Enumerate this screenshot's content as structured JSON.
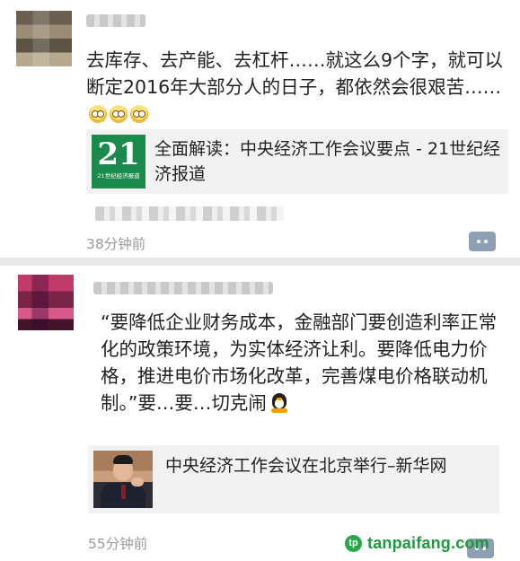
{
  "post1": {
    "text": "去库存、去产能、去杠杆……就这么9个字，就可以断定2016年大部分人的日子，都依然会很艰苦……",
    "emoji_count": 3,
    "card": {
      "thumb_number": "21",
      "thumb_caption": "21世纪经济报道",
      "title": "全面解读：中央经济工作会议要点 - 21世纪经济报道"
    },
    "timestamp": "38分钟前"
  },
  "post2": {
    "text": "“要降低企业财务成本，金融部门要创造利率正常化的政策环境，为实体经济让利。要降低电力价格，推进电价市场化改革，完善煤电价格联动机制。”要…要…切克闹",
    "card": {
      "title": "中央经济工作会议在北京举行–新华网"
    },
    "timestamp": "55分钟前"
  },
  "watermark": {
    "logo": "tp",
    "text": "tanpaifang.com"
  },
  "colors": {
    "accent_green": "#1a8a4d",
    "timestamp_gray": "#9a9a9a",
    "comment_button": "#8f9fb4",
    "watermark_green": "#1d9a3c"
  }
}
